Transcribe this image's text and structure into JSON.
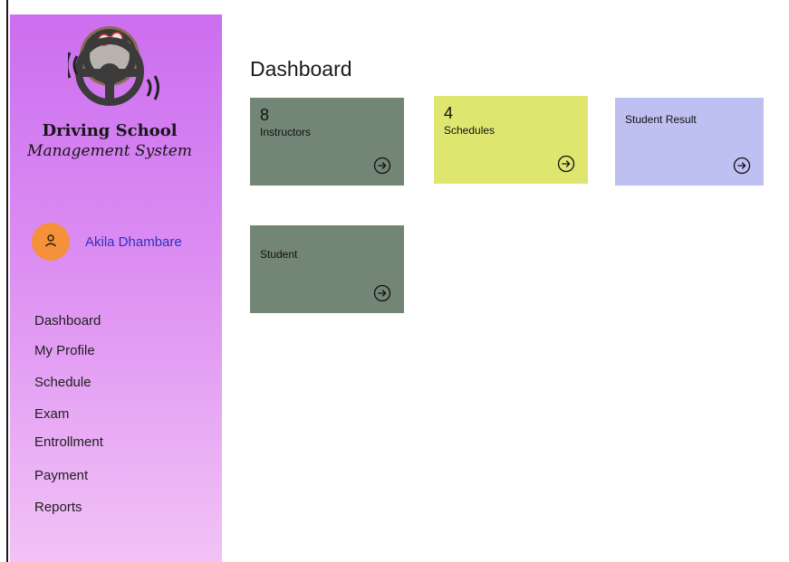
{
  "sidebar": {
    "brand": {
      "line1": "Driving School",
      "line2": "Management System"
    },
    "logo_icon": "steering-wheel-icon",
    "user": {
      "name": "Akila Dhambare",
      "avatar_icon": "user-icon",
      "avatar_color": "#f4913a"
    },
    "nav": [
      {
        "label": "Dashboard"
      },
      {
        "label": "My Profile"
      },
      {
        "label": "Schedule"
      },
      {
        "label": "Exam"
      },
      {
        "label": "Entrollment"
      },
      {
        "label": "Payment"
      },
      {
        "label": "Reports"
      }
    ],
    "gradient": [
      "#cc6ef0",
      "#f2c2f6"
    ]
  },
  "main": {
    "title": "Dashboard",
    "cards": [
      {
        "count": "8",
        "label": "Instructors",
        "color": "#738575",
        "icon": "arrow-right-circle-icon"
      },
      {
        "count": "4",
        "label": "Schedules",
        "color": "#dee670",
        "icon": "arrow-right-circle-icon"
      },
      {
        "label": "Student Result",
        "color": "#bec0f2",
        "icon": "arrow-right-circle-icon"
      },
      {
        "label": "Student",
        "color": "#738575",
        "icon": "arrow-right-circle-icon"
      }
    ]
  }
}
